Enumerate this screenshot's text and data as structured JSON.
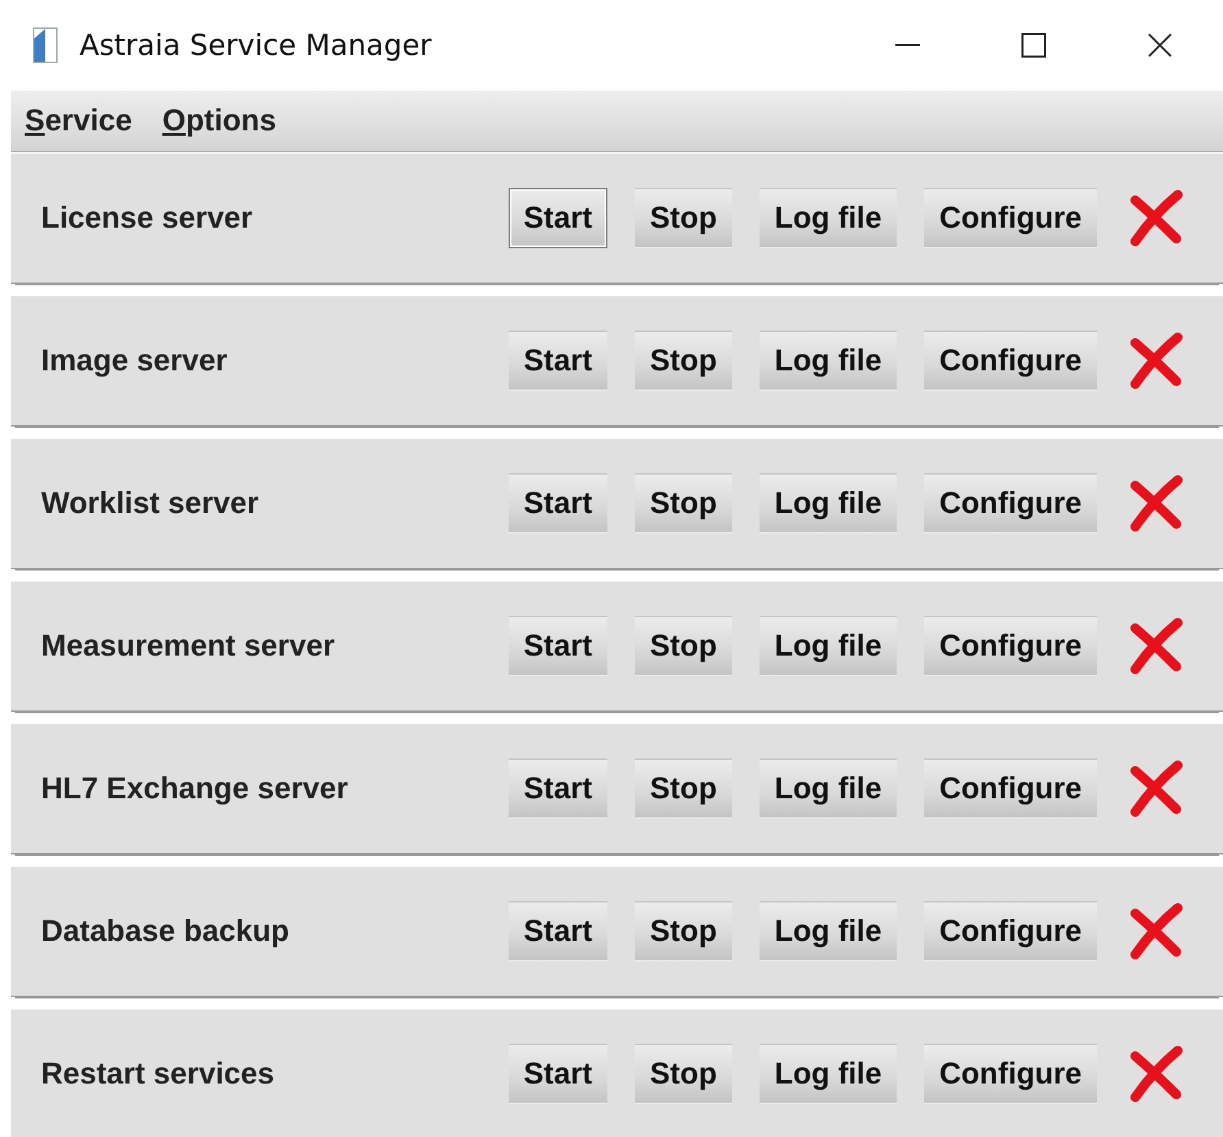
{
  "window": {
    "title": "Astraia Service Manager"
  },
  "menu": [
    {
      "label": "Service"
    },
    {
      "label": "Options"
    }
  ],
  "services": [
    {
      "name": "License server",
      "running": false,
      "buttons": [
        {
          "label": "Start",
          "focused": true
        },
        {
          "label": "Stop",
          "focused": false
        },
        {
          "label": "Log file",
          "focused": false
        },
        {
          "label": "Configure",
          "focused": false
        }
      ]
    },
    {
      "name": "Image server",
      "running": false,
      "buttons": [
        {
          "label": "Start",
          "focused": false
        },
        {
          "label": "Stop",
          "focused": false
        },
        {
          "label": "Log file",
          "focused": false
        },
        {
          "label": "Configure",
          "focused": false
        }
      ]
    },
    {
      "name": "Worklist server",
      "running": false,
      "buttons": [
        {
          "label": "Start",
          "focused": false
        },
        {
          "label": "Stop",
          "focused": false
        },
        {
          "label": "Log file",
          "focused": false
        },
        {
          "label": "Configure",
          "focused": false
        }
      ]
    },
    {
      "name": "Measurement server",
      "running": false,
      "buttons": [
        {
          "label": "Start",
          "focused": false
        },
        {
          "label": "Stop",
          "focused": false
        },
        {
          "label": "Log file",
          "focused": false
        },
        {
          "label": "Configure",
          "focused": false
        }
      ]
    },
    {
      "name": "HL7 Exchange server",
      "running": false,
      "buttons": [
        {
          "label": "Start",
          "focused": false
        },
        {
          "label": "Stop",
          "focused": false
        },
        {
          "label": "Log file",
          "focused": false
        },
        {
          "label": "Configure",
          "focused": false
        }
      ]
    },
    {
      "name": "Database backup",
      "running": false,
      "buttons": [
        {
          "label": "Start",
          "focused": false
        },
        {
          "label": "Stop",
          "focused": false
        },
        {
          "label": "Log file",
          "focused": false
        },
        {
          "label": "Configure",
          "focused": false
        }
      ]
    },
    {
      "name": "Restart services",
      "running": false,
      "buttons": [
        {
          "label": "Start",
          "focused": false
        },
        {
          "label": "Stop",
          "focused": false
        },
        {
          "label": "Log file",
          "focused": false
        },
        {
          "label": "Configure",
          "focused": false
        }
      ]
    }
  ]
}
